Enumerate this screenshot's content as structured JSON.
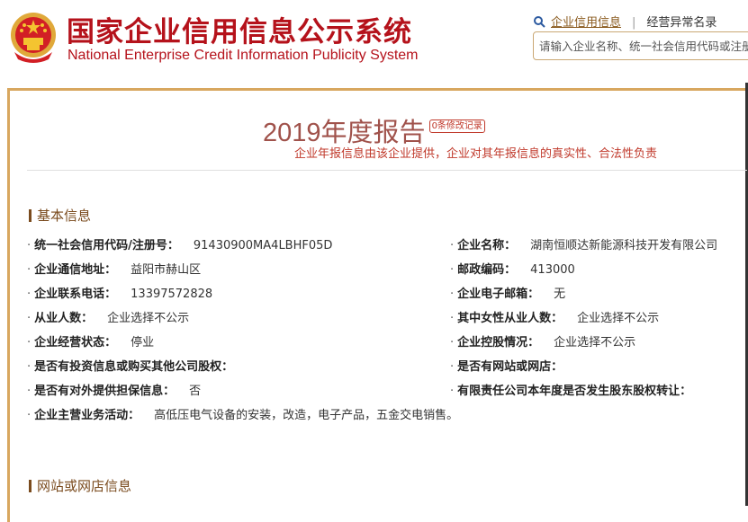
{
  "header": {
    "title_cn": "国家企业信用信息公示系统",
    "title_en": "National Enterprise Credit Information Publicity System",
    "link_credit": "企业信用信息",
    "link_abnormal": "经营异常名录",
    "separator": "|",
    "search_placeholder": "请输入企业名称、统一社会信用代码或注册号"
  },
  "report": {
    "title": "2019年度报告",
    "changes": "0条修改记录",
    "disclaimer": "企业年报信息由该企业提供，企业对其年报信息的真实性、合法性负责"
  },
  "sections": {
    "basic": "基本信息",
    "website": "网站或网店信息"
  },
  "basic_info": {
    "left": [
      {
        "label": "统一社会信用代码/注册号：",
        "value": "91430900MA4LBHF05D"
      },
      {
        "label": "企业通信地址：",
        "value": "益阳市赫山区"
      },
      {
        "label": "企业联系电话：",
        "value": "13397572828"
      },
      {
        "label": "从业人数：",
        "value": "企业选择不公示"
      },
      {
        "label": "企业经营状态：",
        "value": "停业"
      },
      {
        "label": "是否有投资信息或购买其他公司股权：",
        "value": ""
      },
      {
        "label": "是否有对外提供担保信息：",
        "value": "否"
      },
      {
        "label": "企业主营业务活动：",
        "value": "高低压电气设备的安装，改造，电子产品，五金交电销售。"
      }
    ],
    "right": [
      {
        "label": "企业名称：",
        "value": "湖南恒顺达新能源科技开发有限公司"
      },
      {
        "label": "邮政编码：",
        "value": "413000"
      },
      {
        "label": "企业电子邮箱：",
        "value": "无"
      },
      {
        "label": "其中女性从业人数：",
        "value": "企业选择不公示"
      },
      {
        "label": "企业控股情况：",
        "value": "企业选择不公示"
      },
      {
        "label": "是否有网站或网店：",
        "value": ""
      },
      {
        "label": "有限责任公司本年度是否发生股东股权转让：",
        "value": ""
      }
    ]
  },
  "colors": {
    "brand_red": "#b5121b",
    "gold_border": "#d8a75f",
    "section_brown": "#7a4b1e",
    "disclaimer_red": "#c0392b"
  }
}
